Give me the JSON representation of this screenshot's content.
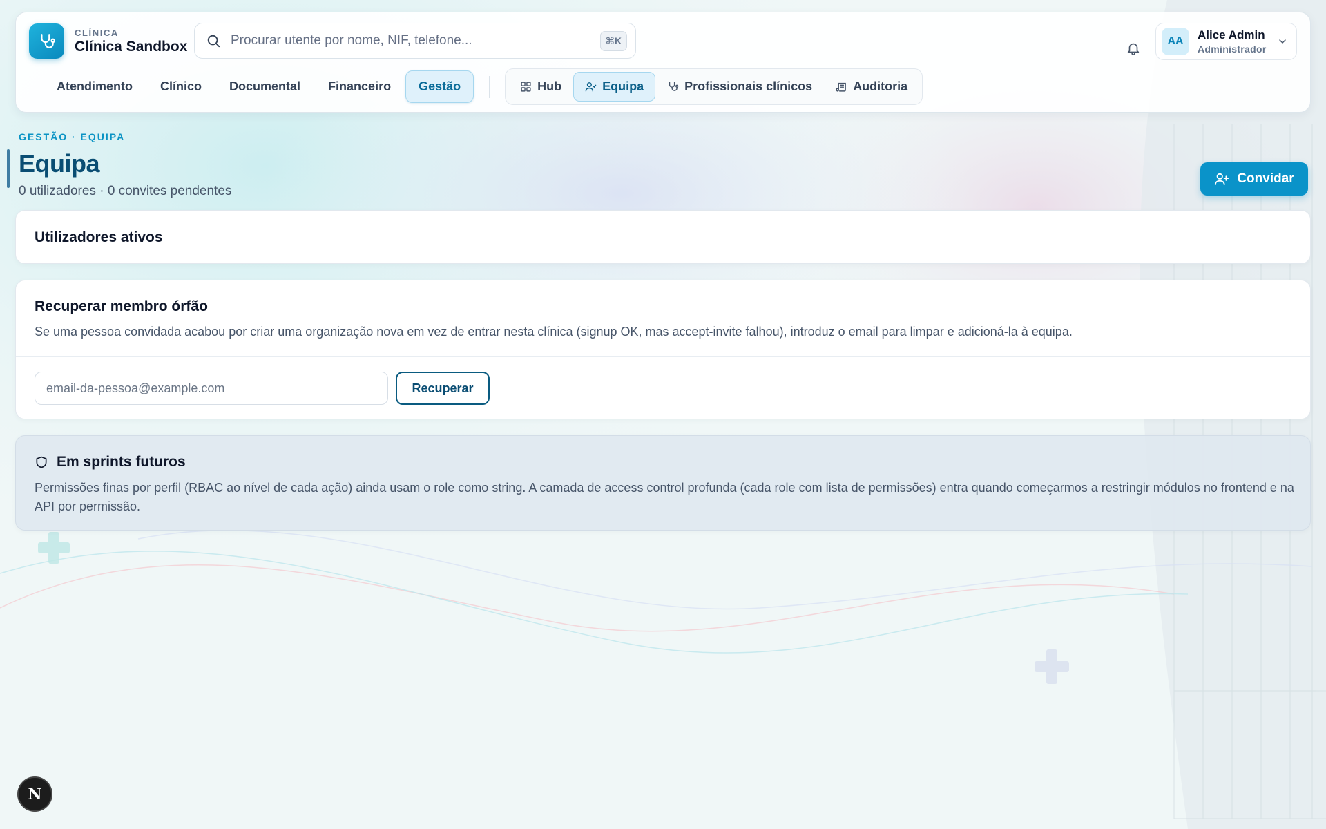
{
  "brand": {
    "kicker": "CLÍNICA",
    "name": "Clínica Sandbox"
  },
  "search": {
    "placeholder": "Procurar utente por nome, NIF, telefone...",
    "value": "",
    "shortcut": "⌘K"
  },
  "notifications": {
    "icon": "bell-icon"
  },
  "user": {
    "initials": "AA",
    "name": "Alice Admin",
    "role": "Administrador"
  },
  "nav": {
    "items": [
      {
        "label": "Atendimento",
        "active": false
      },
      {
        "label": "Clínico",
        "active": false
      },
      {
        "label": "Documental",
        "active": false
      },
      {
        "label": "Financeiro",
        "active": false
      },
      {
        "label": "Gestão",
        "active": true
      }
    ],
    "subitems": [
      {
        "label": "Hub",
        "icon": "grid-icon",
        "active": false
      },
      {
        "label": "Equipa",
        "icon": "user-icon",
        "active": true
      },
      {
        "label": "Profissionais clínicos",
        "icon": "stethoscope-icon",
        "active": false
      },
      {
        "label": "Auditoria",
        "icon": "scroll-icon",
        "active": false
      }
    ]
  },
  "page": {
    "breadcrumb": "GESTÃO · EQUIPA",
    "title": "Equipa",
    "subtitle": "0 utilizadores · 0 convites pendentes",
    "invite_label": "Convidar"
  },
  "active_users": {
    "title": "Utilizadores ativos"
  },
  "orphan": {
    "title": "Recuperar membro órfão",
    "description": "Se uma pessoa convidada acabou por criar uma organização nova em vez de entrar nesta clínica (signup OK, mas accept-invite falhou), introduz o email para limpar e adicioná-la à equipa.",
    "email_placeholder": "email-da-pessoa@example.com",
    "email_value": "",
    "button_label": "Recuperar"
  },
  "future": {
    "title": "Em sprints futuros",
    "text": "Permissões finas por perfil (RBAC ao nível de cada ação) ainda usam o role como string. A camada de access control profunda (cada role com lista de permissões) entra quando começarmos a restringir módulos no frontend e na API por permissão."
  },
  "dev_badge": {
    "letter": "N"
  },
  "colors": {
    "accent": "#0a93c9",
    "title": "#0a4d73",
    "active_tab_bg": "#dff1fb"
  }
}
